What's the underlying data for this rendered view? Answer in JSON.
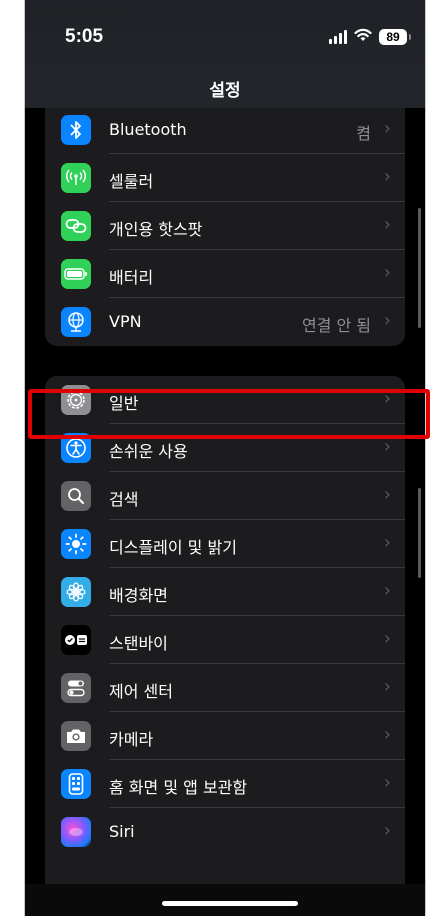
{
  "status_bar": {
    "time": "5:05",
    "battery_level": "89"
  },
  "nav": {
    "title": "설정"
  },
  "groups": [
    {
      "items": [
        {
          "label": "Bluetooth",
          "value": "켬",
          "icon": "bluetooth-icon",
          "color": "#0a84ff"
        },
        {
          "label": "셀룰러",
          "value": "",
          "icon": "antenna-icon",
          "color": "#30d158"
        },
        {
          "label": "개인용 핫스팟",
          "value": "",
          "icon": "link-icon",
          "color": "#30d158"
        },
        {
          "label": "배터리",
          "value": "",
          "icon": "battery-icon",
          "color": "#30d158"
        },
        {
          "label": "VPN",
          "value": "연결 안 됨",
          "icon": "globe-icon",
          "color": "#0a84ff"
        }
      ]
    },
    {
      "items": [
        {
          "label": "일반",
          "value": "",
          "icon": "gear-icon",
          "color": "#8e8e93"
        },
        {
          "label": "손쉬운 사용",
          "value": "",
          "icon": "accessibility-icon",
          "color": "#0a84ff"
        },
        {
          "label": "검색",
          "value": "",
          "icon": "search-icon",
          "color": "#636366"
        },
        {
          "label": "디스플레이 및 밝기",
          "value": "",
          "icon": "brightness-icon",
          "color": "#0a84ff"
        },
        {
          "label": "배경화면",
          "value": "",
          "icon": "flower-icon",
          "color": "#32ade6"
        },
        {
          "label": "스탠바이",
          "value": "",
          "icon": "standby-icon",
          "color": "#000000"
        },
        {
          "label": "제어 센터",
          "value": "",
          "icon": "toggles-icon",
          "color": "#636366"
        },
        {
          "label": "카메라",
          "value": "",
          "icon": "camera-icon",
          "color": "#636366"
        },
        {
          "label": "홈 화면 및 앱 보관함",
          "value": "",
          "icon": "home-screen-icon",
          "color": "#0a84ff"
        },
        {
          "label": "Siri",
          "value": "",
          "icon": "siri-icon",
          "color": "#5e5ce6"
        }
      ]
    }
  ],
  "chevron": "›"
}
